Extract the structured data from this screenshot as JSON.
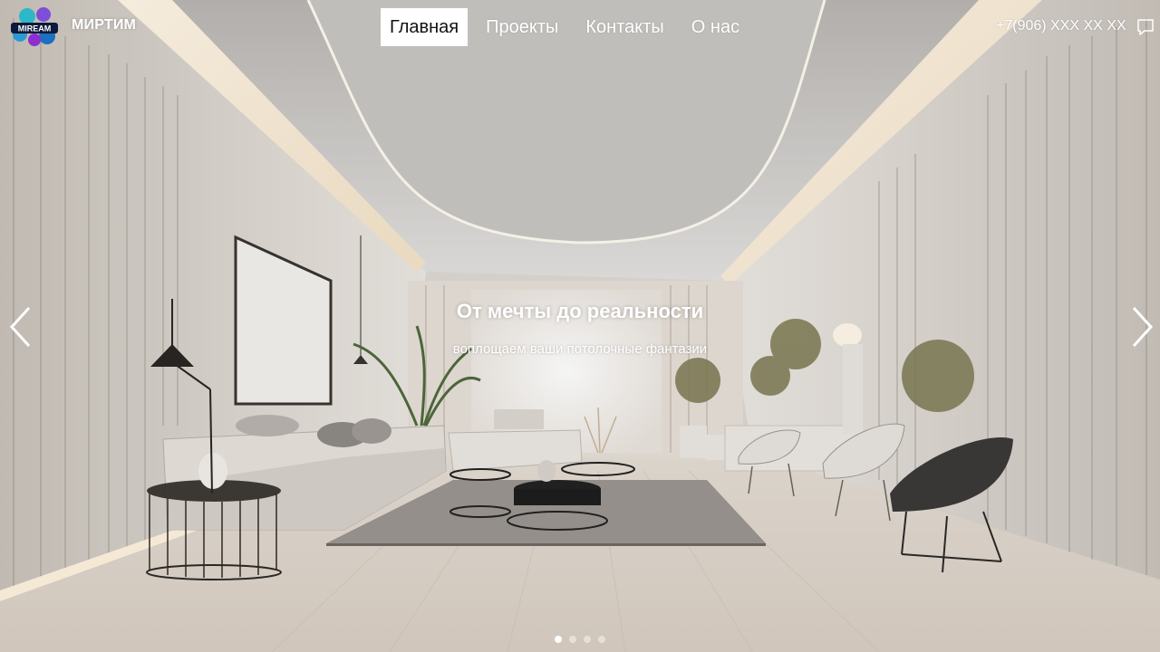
{
  "header": {
    "logo_text": "MIREAM",
    "brand": "МИРТИМ",
    "nav": [
      {
        "label": "Главная",
        "active": true
      },
      {
        "label": "Проекты",
        "active": false
      },
      {
        "label": "Контакты",
        "active": false
      },
      {
        "label": "О нас",
        "active": false
      }
    ],
    "phone": "+7(906) XXX XX XX",
    "chat_icon": "chat-bubble-icon"
  },
  "slider": {
    "title": "От мечты до реальности",
    "subtitle": "воплощаем ваши потолочные фантазии",
    "prev_icon": "chevron-left-icon",
    "next_icon": "chevron-right-icon",
    "dots": [
      true,
      false,
      false,
      false
    ]
  },
  "colors": {
    "nav_active_bg": "#ffffff",
    "text": "#ffffff"
  }
}
